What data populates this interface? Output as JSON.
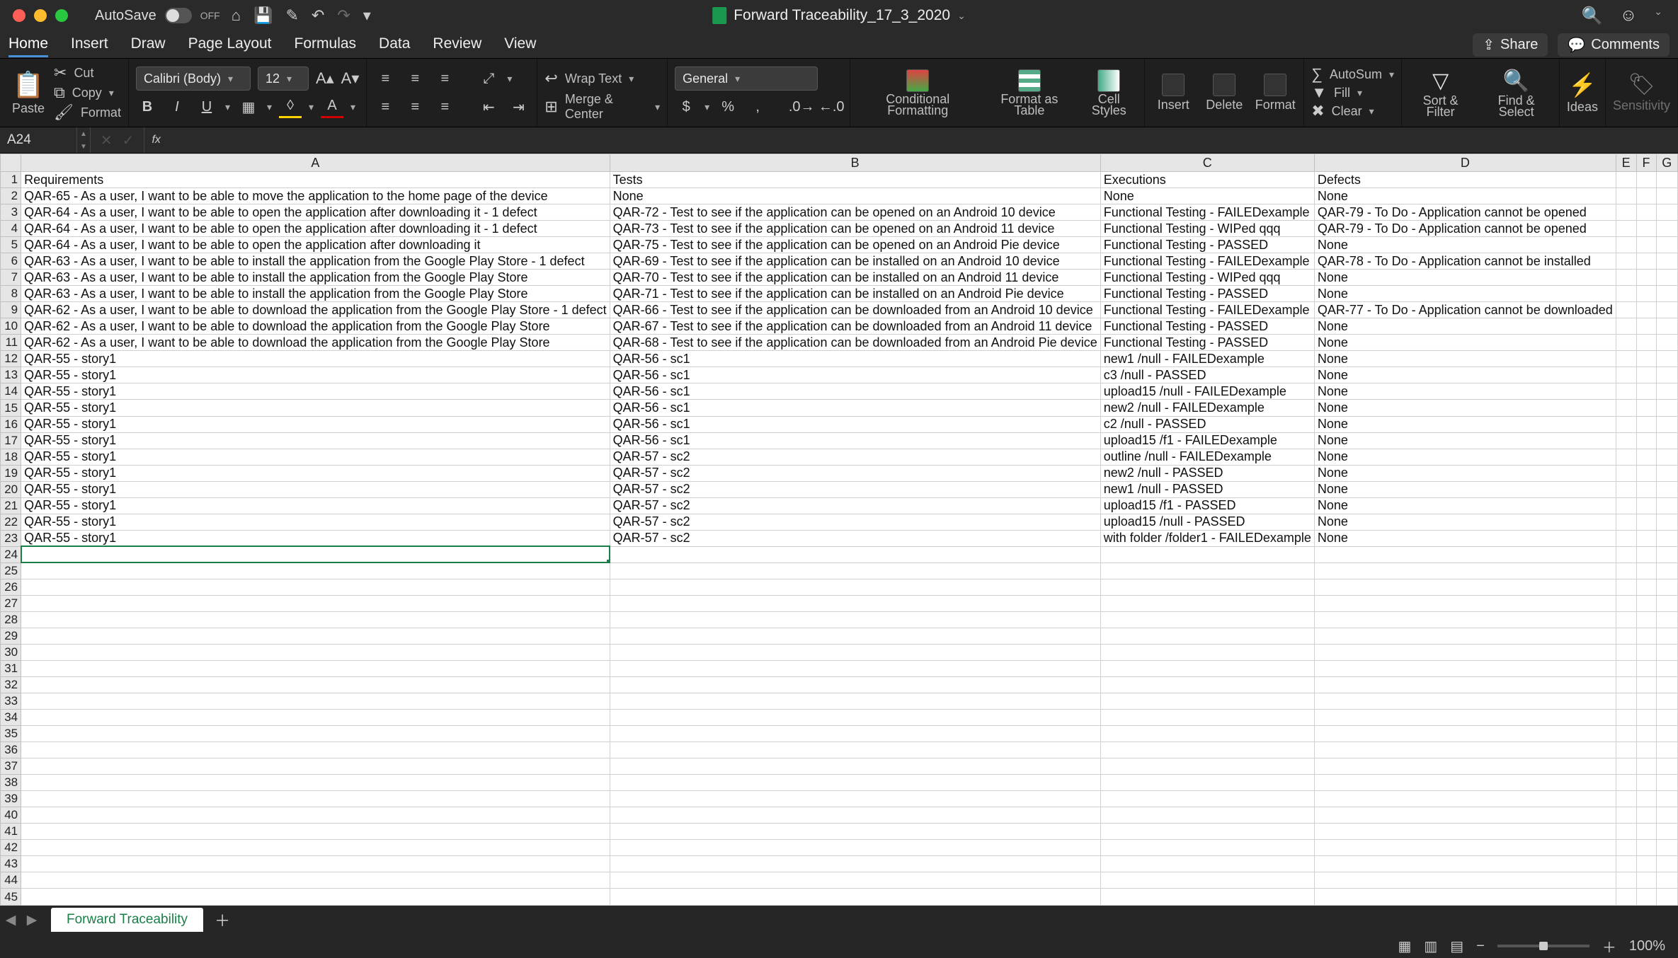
{
  "titlebar": {
    "autosave_label": "AutoSave",
    "autosave_state": "OFF",
    "doc_name": "Forward Traceability_17_3_2020"
  },
  "tabs": {
    "items": [
      "Home",
      "Insert",
      "Draw",
      "Page Layout",
      "Formulas",
      "Data",
      "Review",
      "View"
    ],
    "active": "Home"
  },
  "share_label": "Share",
  "comments_label": "Comments",
  "ribbon": {
    "paste": "Paste",
    "cut": "Cut",
    "copy": "Copy",
    "format": "Format",
    "font_name": "Calibri (Body)",
    "font_size": "12",
    "wrap": "Wrap Text",
    "merge": "Merge & Center",
    "number_format": "General",
    "cond_fmt": "Conditional Formatting",
    "fmt_table": "Format as Table",
    "cell_styles": "Cell Styles",
    "insert": "Insert",
    "delete": "Delete",
    "format_col": "Format",
    "autosum": "AutoSum",
    "fill": "Fill",
    "clear": "Clear",
    "sort": "Sort & Filter",
    "find": "Find & Select",
    "ideas": "Ideas",
    "sensitivity": "Sensitivity"
  },
  "formula_bar": {
    "cell_ref": "A24"
  },
  "columns": {
    "A": 748,
    "B": 622,
    "C": 276,
    "D": 378,
    "E": 92,
    "F": 92,
    "G": 92
  },
  "headers": [
    "A",
    "B",
    "C",
    "D",
    "E",
    "F",
    "G"
  ],
  "row_header_label": "Requirements",
  "rows": [
    {
      "a": "Requirements",
      "b": "Tests",
      "c": "Executions",
      "d": "Defects"
    },
    {
      "a": "QAR-65 - As a user, I want to be able to move the application to the home page of the device",
      "b": "None",
      "c": "None",
      "d": "None"
    },
    {
      "a": "QAR-64 - As a user, I want to be able to open the application after downloading it - 1 defect",
      "b": "QAR-72 - Test to see if the application can be opened on an Android 10 device",
      "c": "Functional Testing  - FAILEDexample",
      "d": "QAR-79 - To Do - Application cannot be opened"
    },
    {
      "a": "QAR-64 - As a user, I want to be able to open the application after downloading it - 1 defect",
      "b": "QAR-73 - Test to see if the application can be opened on an Android 11 device",
      "c": "Functional Testing  - WIPed qqq",
      "d": "QAR-79 - To Do - Application cannot be opened"
    },
    {
      "a": "QAR-64 - As a user, I want to be able to open the application after downloading it",
      "b": "QAR-75 - Test to see if the application can be opened on an Android Pie device",
      "c": "Functional Testing  - PASSED",
      "d": "None"
    },
    {
      "a": "QAR-63 - As a user, I want to be able to install the application from the Google Play Store - 1 defect",
      "b": "QAR-69 - Test to see if the application can be installed on an Android 10 device",
      "c": "Functional Testing  - FAILEDexample",
      "d": "QAR-78 - To Do - Application cannot be installed"
    },
    {
      "a": "QAR-63 - As a user, I want to be able to install the application from the Google Play Store",
      "b": "QAR-70 - Test to see if the application can be installed on an Android 11 device",
      "c": "Functional Testing  - WIPed qqq",
      "d": "None"
    },
    {
      "a": "QAR-63 - As a user, I want to be able to install the application from the Google Play Store",
      "b": "QAR-71 - Test to see if the application can be installed on an Android Pie device",
      "c": "Functional Testing  - PASSED",
      "d": "None"
    },
    {
      "a": "QAR-62 - As a user, I want to be able to download the application from the Google Play Store - 1 defect",
      "b": "QAR-66 - Test to see if the application can be downloaded from an Android 10 device",
      "c": "Functional Testing  - FAILEDexample",
      "d": "QAR-77 - To Do - Application cannot be downloaded"
    },
    {
      "a": "QAR-62 - As a user, I want to be able to download the application from the Google Play Store",
      "b": "QAR-67 - Test to see if the application can be downloaded from an Android 11 device",
      "c": "Functional Testing  - PASSED",
      "d": "None"
    },
    {
      "a": "QAR-62 - As a user, I want to be able to download the application from the Google Play Store",
      "b": "QAR-68 - Test to see if the application can be downloaded from an Android Pie device",
      "c": "Functional Testing  - PASSED",
      "d": "None"
    },
    {
      "a": "QAR-55 - story1",
      "b": "QAR-56 - sc1",
      "c": "new1 /null - FAILEDexample",
      "d": "None"
    },
    {
      "a": "QAR-55 - story1",
      "b": "QAR-56 - sc1",
      "c": "c3 /null - PASSED",
      "d": "None"
    },
    {
      "a": "QAR-55 - story1",
      "b": "QAR-56 - sc1",
      "c": "upload15 /null - FAILEDexample",
      "d": "None"
    },
    {
      "a": "QAR-55 - story1",
      "b": "QAR-56 - sc1",
      "c": "new2 /null - FAILEDexample",
      "d": "None"
    },
    {
      "a": "QAR-55 - story1",
      "b": "QAR-56 - sc1",
      "c": "c2 /null - PASSED",
      "d": "None"
    },
    {
      "a": "QAR-55 - story1",
      "b": "QAR-56 - sc1",
      "c": "upload15 /f1 - FAILEDexample",
      "d": "None"
    },
    {
      "a": "QAR-55 - story1",
      "b": "QAR-57 - sc2",
      "c": "outline /null - FAILEDexample",
      "d": "None"
    },
    {
      "a": "QAR-55 - story1",
      "b": "QAR-57 - sc2",
      "c": "new2 /null - PASSED",
      "d": "None"
    },
    {
      "a": "QAR-55 - story1",
      "b": "QAR-57 - sc2",
      "c": "new1 /null - PASSED",
      "d": "None"
    },
    {
      "a": "QAR-55 - story1",
      "b": "QAR-57 - sc2",
      "c": "upload15 /f1 - PASSED",
      "d": "None"
    },
    {
      "a": "QAR-55 - story1",
      "b": "QAR-57 - sc2",
      "c": "upload15 /null - PASSED",
      "d": "None"
    },
    {
      "a": "QAR-55 - story1",
      "b": "QAR-57 - sc2",
      "c": "with folder /folder1 - FAILEDexample",
      "d": "None"
    }
  ],
  "empty_rows_from": 24,
  "empty_rows_to": 45,
  "selected_cell": {
    "row": 24,
    "col": "A"
  },
  "sheet_tab": "Forward Traceability",
  "zoom": "100%"
}
